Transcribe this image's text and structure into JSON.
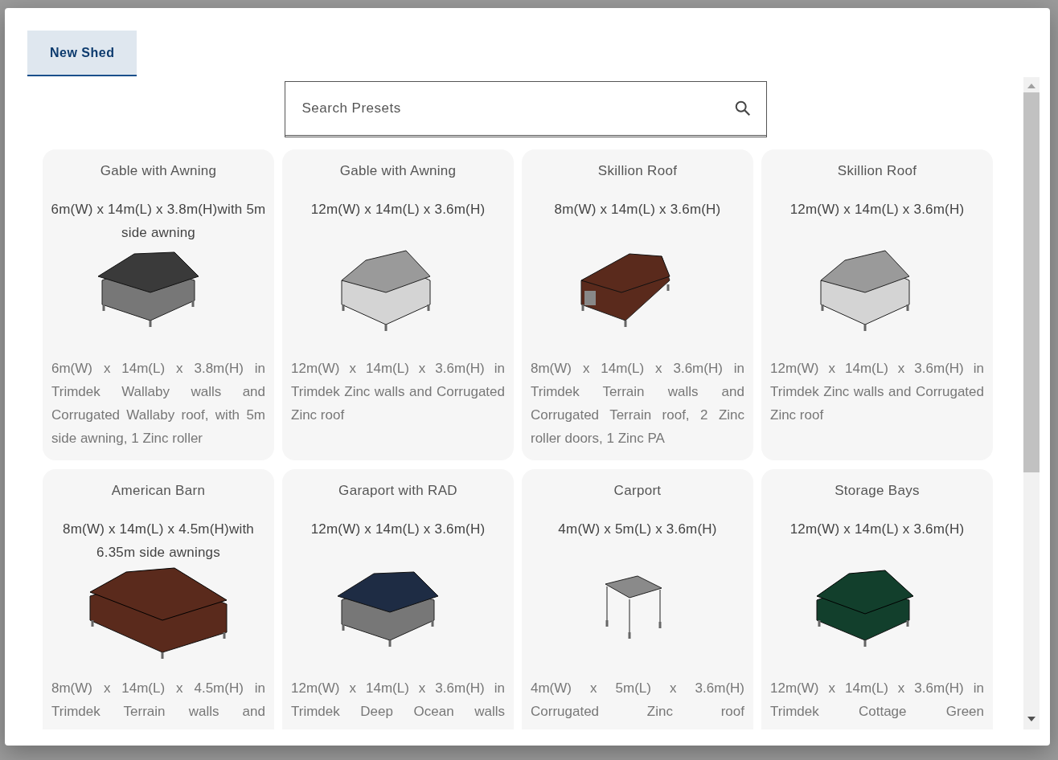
{
  "tabs": [
    {
      "label": "New Shed",
      "selected": true
    }
  ],
  "search": {
    "placeholder": "Search Presets"
  },
  "presets": [
    {
      "title": "Gable with Awning",
      "dimensions": "6m(W) x 14m(L) x 3.8m(H)with 5m side awning",
      "description": "6m(W) x 14m(L) x 3.8m(H) in Trimdek Wallaby walls and Corrugated Wallaby roof, with 5m side awning, 1 Zinc roller",
      "kind": "awning",
      "color": "#3a3a3a"
    },
    {
      "title": "Gable with Awning",
      "dimensions": "12m(W) x 14m(L) x 3.6m(H)",
      "description": "12m(W) x 14m(L) x 3.6m(H) in Trimdek Zinc walls and Corrugated Zinc roof",
      "kind": "gable",
      "color": "#9a9a9a"
    },
    {
      "title": "Skillion Roof",
      "dimensions": "8m(W) x 14m(L) x 3.6m(H)",
      "description": "8m(W) x 14m(L) x 3.6m(H) in Trimdek Terrain walls and Corrugated Terrain roof, 2 Zinc roller doors, 1 Zinc PA",
      "kind": "skillion",
      "color": "#5a2a1c"
    },
    {
      "title": "Skillion Roof",
      "dimensions": "12m(W) x 14m(L) x 3.6m(H)",
      "description": "12m(W) x 14m(L) x 3.6m(H) in Trimdek Zinc walls and Corrugated Zinc roof",
      "kind": "gable",
      "color": "#9a9a9a"
    },
    {
      "title": "American Barn",
      "dimensions": "8m(W) x 14m(L) x 4.5m(H)with 6.35m side awnings",
      "description": "8m(W) x 14m(L) x 4.5m(H) in Trimdek Terrain walls and",
      "kind": "barn",
      "color": "#5a2a1c"
    },
    {
      "title": "Garaport with RAD",
      "dimensions": "12m(W) x 14m(L) x 3.6m(H)",
      "description": "12m(W) x 14m(L) x 3.6m(H) in Trimdek Deep Ocean walls",
      "kind": "awning",
      "color": "#1e2c44"
    },
    {
      "title": "Carport",
      "dimensions": "4m(W) x 5m(L) x 3.6m(H)",
      "description": "4m(W) x 5m(L) x 3.6m(H) Corrugated Zinc roof",
      "kind": "carport",
      "color": "#8a8a8a"
    },
    {
      "title": "Storage Bays",
      "dimensions": "12m(W) x 14m(L) x 3.6m(H)",
      "description": "12m(W) x 14m(L) x 3.6m(H) in Trimdek Cottage Green",
      "kind": "bays",
      "color": "#123f2c"
    }
  ]
}
